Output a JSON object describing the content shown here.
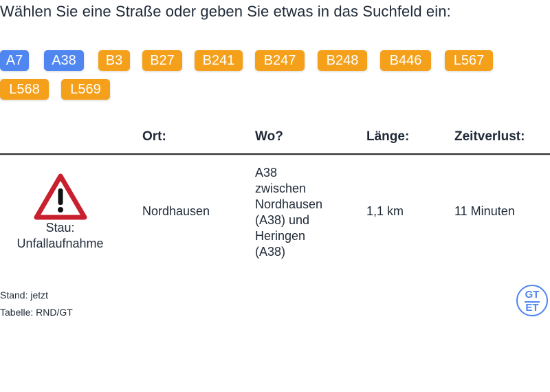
{
  "prompt": "Wählen Sie eine Straße oder geben Sie etwas in das Suchfeld ein:",
  "roads": [
    {
      "label": "A7",
      "color": "#4f86f0"
    },
    {
      "label": "A38",
      "color": "#4f86f0"
    },
    {
      "label": "B3",
      "color": "#f5a01a"
    },
    {
      "label": "B27",
      "color": "#f5a01a"
    },
    {
      "label": "B241",
      "color": "#f5a01a"
    },
    {
      "label": "B247",
      "color": "#f5a01a"
    },
    {
      "label": "B248",
      "color": "#f5a01a"
    },
    {
      "label": "B446",
      "color": "#f5a01a"
    },
    {
      "label": "L567",
      "color": "#f5a01a"
    },
    {
      "label": "L568",
      "color": "#f5a01a"
    },
    {
      "label": "L569",
      "color": "#f5a01a"
    }
  ],
  "table": {
    "headers": {
      "ort": "Ort:",
      "wo": "Wo?",
      "laenge": "Länge:",
      "zeitverlust": "Zeitverlust:"
    },
    "rows": [
      {
        "icon": "warning-triangle-icon",
        "type_line1": "Stau:",
        "type_line2": "Unfallaufnahme",
        "ort": "Nordhausen",
        "wo_lines": [
          "A38",
          "zwischen",
          "Nordhausen",
          "(A38) und",
          "Heringen",
          "(A38)"
        ],
        "laenge": "1,1 km",
        "zeitverlust": "11 Minuten"
      }
    ]
  },
  "stand": "Stand: jetzt",
  "tabelle": "Tabelle: RND/GT",
  "logo": {
    "line1": "GT",
    "line2": "ET",
    "color": "#4f86f0"
  }
}
